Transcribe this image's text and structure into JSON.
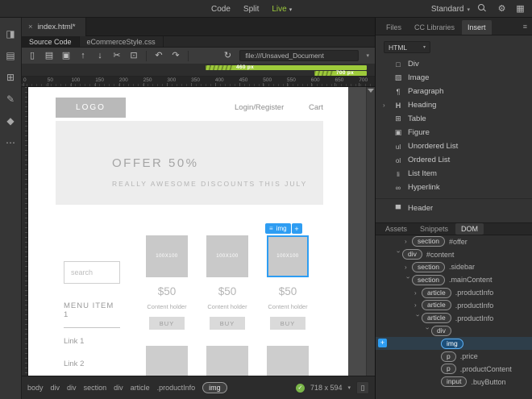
{
  "topbar": {
    "modes": [
      {
        "label": "Code"
      },
      {
        "label": "Split"
      },
      {
        "label": "Live",
        "active": true,
        "caret": true
      }
    ],
    "workspace": "Standard",
    "icons": [
      "search-icon",
      "gear-icon",
      "workspace-icon"
    ]
  },
  "left_toolbar": {
    "icons": [
      "extract-icon",
      "files-icon",
      "insert-icon",
      "css-designer-icon",
      "behaviors-icon",
      "more-icon"
    ]
  },
  "document": {
    "tab_title": "index.html*",
    "related_files": [
      {
        "label": "Source Code",
        "active": true
      },
      {
        "label": "eCommerceStyle.css"
      }
    ],
    "toolbar_icons": [
      "new-file-icon",
      "open-file-icon",
      "save-file-icon",
      "upload-icon",
      "download-icon",
      "cut-icon",
      "copy-icon"
    ],
    "history_icons": [
      "undo-icon",
      "redo-icon"
    ],
    "refresh_icon": "refresh-icon",
    "url": "file:///Unsaved_Document"
  },
  "media_queries": [
    {
      "label": "460 px"
    },
    {
      "label": "700 px"
    }
  ],
  "ruler": {
    "labels": [
      "0",
      "50",
      "100",
      "150",
      "200",
      "250",
      "300",
      "350",
      "400",
      "450",
      "500",
      "550",
      "600",
      "650",
      "700"
    ]
  },
  "page": {
    "logo": "LOGO",
    "nav_login": "Login/Register",
    "nav_cart": "Cart",
    "hero_title": "OFFER 50%",
    "hero_subtitle": "REALLY AWESOME DISCOUNTS THIS JULY",
    "sidebar": {
      "search_placeholder": "search",
      "menu_title": "MENU ITEM 1",
      "links": [
        "Link 1",
        "Link 2"
      ]
    },
    "products": [
      {
        "image_label": "100X100",
        "price": "$50",
        "content": "Content holder",
        "buy_label": "BUY"
      },
      {
        "image_label": "100X100",
        "price": "$50",
        "content": "Content holder",
        "buy_label": "BUY"
      },
      {
        "image_label": "100X100",
        "price": "$50",
        "content": "Content holder",
        "buy_label": "BUY",
        "selected": true,
        "badge": {
          "icon": "hamburger-icon",
          "tag": "img",
          "add": "+"
        }
      }
    ]
  },
  "insert_panel": {
    "tabs": [
      {
        "label": "Files"
      },
      {
        "label": "CC Libraries"
      },
      {
        "label": "Insert",
        "active": true
      }
    ],
    "category": "HTML",
    "items": [
      {
        "icon": "div-icon",
        "label": "Div"
      },
      {
        "icon": "image-icon",
        "label": "Image"
      },
      {
        "icon": "paragraph-icon",
        "label": "Paragraph"
      },
      {
        "icon": "heading-icon",
        "label": "Heading",
        "expandable": true
      },
      {
        "icon": "table-icon",
        "label": "Table"
      },
      {
        "icon": "figure-icon",
        "label": "Figure"
      },
      {
        "icon": "ul-icon",
        "label": "Unordered List"
      },
      {
        "icon": "ol-icon",
        "label": "Ordered List"
      },
      {
        "icon": "li-icon",
        "label": "List Item"
      },
      {
        "icon": "hyperlink-icon",
        "label": "Hyperlink"
      },
      {
        "separator": true
      },
      {
        "icon": "header-icon",
        "label": "Header"
      }
    ]
  },
  "dom_panel": {
    "tabs": [
      {
        "label": "Assets"
      },
      {
        "label": "Snippets"
      },
      {
        "label": "DOM",
        "active": true
      }
    ],
    "nodes": [
      {
        "indent": 2,
        "state": "collapsed",
        "tag": "section",
        "label": "#offer"
      },
      {
        "indent": 1,
        "state": "expanded",
        "tag": "div",
        "label": "#content"
      },
      {
        "indent": 2,
        "state": "collapsed",
        "tag": "section",
        "label": ".sidebar"
      },
      {
        "indent": 2,
        "state": "expanded",
        "tag": "section",
        "label": ".mainContent"
      },
      {
        "indent": 3,
        "state": "collapsed",
        "tag": "article",
        "label": ".productInfo"
      },
      {
        "indent": 3,
        "state": "collapsed",
        "tag": "article",
        "label": ".productInfo"
      },
      {
        "indent": 3,
        "state": "expanded",
        "tag": "article",
        "label": ".productInfo"
      },
      {
        "indent": 4,
        "state": "expanded",
        "tag": "div",
        "label": ""
      },
      {
        "indent": 5,
        "state": "leaf",
        "tag": "img",
        "label": "",
        "selected": true,
        "add_label": "+"
      },
      {
        "indent": 5,
        "state": "leaf",
        "tag": "p",
        "label": ".price"
      },
      {
        "indent": 5,
        "state": "leaf",
        "tag": "p",
        "label": ".productContent"
      },
      {
        "indent": 5,
        "state": "leaf",
        "tag": "input",
        "label": ".buyButton"
      }
    ]
  },
  "statusbar": {
    "tags": [
      {
        "label": "body"
      },
      {
        "label": "div"
      },
      {
        "label": "div"
      },
      {
        "label": "section"
      },
      {
        "label": "div"
      },
      {
        "label": "article"
      },
      {
        "label": ".productInfo"
      },
      {
        "label": "img",
        "active": true
      }
    ],
    "size": "718 x 594",
    "ok_icon": "check-icon",
    "device_icon": "device-preview-icon"
  }
}
